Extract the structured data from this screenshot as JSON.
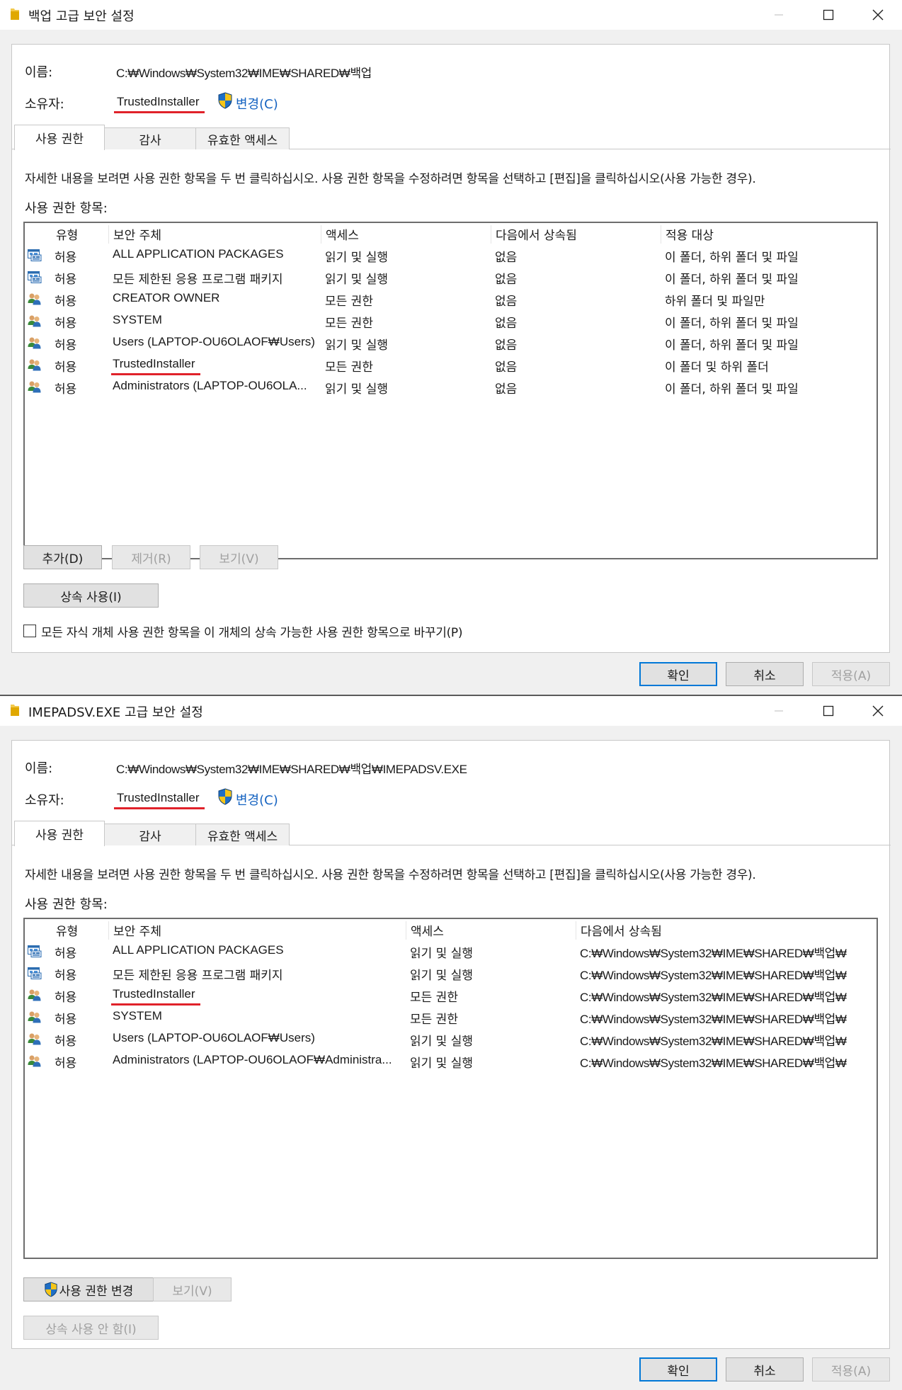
{
  "dialog1": {
    "title": "백업 고급 보안 설정",
    "name_label": "이름:",
    "name_value": "C:₩Windows₩System32₩IME₩SHARED₩백업",
    "owner_label": "소유자:",
    "owner_value": "TrustedInstaller",
    "change_link": "변경(C)",
    "tabs": [
      "사용 권한",
      "감사",
      "유효한 액세스"
    ],
    "description": "자세한 내용을 보려면 사용 권한 항목을 두 번 클릭하십시오. 사용 권한 항목을 수정하려면 항목을 선택하고 [편집]을 클릭하십시오(사용 가능한 경우).",
    "entries_label": "사용 권한 항목:",
    "columns": [
      "유형",
      "보안 주체",
      "액세스",
      "다음에서 상속됨",
      "적용 대상"
    ],
    "rows": [
      {
        "icon": "package-icon",
        "type": "허용",
        "principal": "ALL APPLICATION PACKAGES",
        "access": "읽기 및 실행",
        "inherited": "없음",
        "applies": "이 폴더, 하위 폴더 및 파일"
      },
      {
        "icon": "package-icon",
        "type": "허용",
        "principal": "모든 제한된 응용 프로그램 패키지",
        "access": "읽기 및 실행",
        "inherited": "없음",
        "applies": "이 폴더, 하위 폴더 및 파일"
      },
      {
        "icon": "users-icon",
        "type": "허용",
        "principal": "CREATOR OWNER",
        "access": "모든 권한",
        "inherited": "없음",
        "applies": "하위 폴더 및 파일만"
      },
      {
        "icon": "users-icon",
        "type": "허용",
        "principal": "SYSTEM",
        "access": "모든 권한",
        "inherited": "없음",
        "applies": "이 폴더, 하위 폴더 및 파일"
      },
      {
        "icon": "users-icon",
        "type": "허용",
        "principal": "Users (LAPTOP-OU6OLAOF₩Users)",
        "access": "읽기 및 실행",
        "inherited": "없음",
        "applies": "이 폴더, 하위 폴더 및 파일"
      },
      {
        "icon": "users-icon",
        "type": "허용",
        "principal": "TrustedInstaller",
        "access": "모든 권한",
        "inherited": "없음",
        "applies": "이 폴더 및 하위 폴더"
      },
      {
        "icon": "users-icon",
        "type": "허용",
        "principal": "Administrators (LAPTOP-OU6OLA...",
        "access": "읽기 및 실행",
        "inherited": "없음",
        "applies": "이 폴더, 하위 폴더 및 파일"
      }
    ],
    "buttons": {
      "add": "추가(D)",
      "remove": "제거(R)",
      "view": "보기(V)",
      "enable_inheritance": "상속 사용(I)"
    },
    "replace_checkbox_label": "모든 자식 개체 사용 권한 항목을 이 개체의 상속 가능한 사용 권한 항목으로 바꾸기(P)",
    "footer": {
      "ok": "확인",
      "cancel": "취소",
      "apply": "적용(A)"
    }
  },
  "dialog2": {
    "title": "IMEPADSV.EXE 고급 보안 설정",
    "name_label": "이름:",
    "name_value": "C:₩Windows₩System32₩IME₩SHARED₩백업₩IMEPADSV.EXE",
    "owner_label": "소유자:",
    "owner_value": "TrustedInstaller",
    "change_link": "변경(C)",
    "tabs": [
      "사용 권한",
      "감사",
      "유효한 액세스"
    ],
    "description": "자세한 내용을 보려면 사용 권한 항목을 두 번 클릭하십시오. 사용 권한 항목을 수정하려면 항목을 선택하고 [편집]을 클릭하십시오(사용 가능한 경우).",
    "entries_label": "사용 권한 항목:",
    "columns": [
      "유형",
      "보안 주체",
      "액세스",
      "다음에서 상속됨"
    ],
    "rows": [
      {
        "icon": "package-icon",
        "type": "허용",
        "principal": "ALL APPLICATION PACKAGES",
        "access": "읽기 및 실행",
        "inherited": "C:₩Windows₩System32₩IME₩SHARED₩백업₩"
      },
      {
        "icon": "package-icon",
        "type": "허용",
        "principal": "모든 제한된 응용 프로그램 패키지",
        "access": "읽기 및 실행",
        "inherited": "C:₩Windows₩System32₩IME₩SHARED₩백업₩"
      },
      {
        "icon": "users-icon",
        "type": "허용",
        "principal": "TrustedInstaller",
        "access": "모든 권한",
        "inherited": "C:₩Windows₩System32₩IME₩SHARED₩백업₩"
      },
      {
        "icon": "users-icon",
        "type": "허용",
        "principal": "SYSTEM",
        "access": "모든 권한",
        "inherited": "C:₩Windows₩System32₩IME₩SHARED₩백업₩"
      },
      {
        "icon": "users-icon",
        "type": "허용",
        "principal": "Users (LAPTOP-OU6OLAOF₩Users)",
        "access": "읽기 및 실행",
        "inherited": "C:₩Windows₩System32₩IME₩SHARED₩백업₩"
      },
      {
        "icon": "users-icon",
        "type": "허용",
        "principal": "Administrators (LAPTOP-OU6OLAOF₩Administra...",
        "access": "읽기 및 실행",
        "inherited": "C:₩Windows₩System32₩IME₩SHARED₩백업₩"
      }
    ],
    "buttons": {
      "change_permissions": "사용 권한 변경",
      "view": "보기(V)",
      "disable_inheritance": "상속 사용 안 함(I)"
    },
    "footer": {
      "ok": "확인",
      "cancel": "취소",
      "apply": "적용(A)"
    }
  },
  "colors": {
    "accent": "#0078d7",
    "link": "#1563c1",
    "highlight_underline": "#e0222a",
    "disabled_text": "#a0a0a0"
  }
}
